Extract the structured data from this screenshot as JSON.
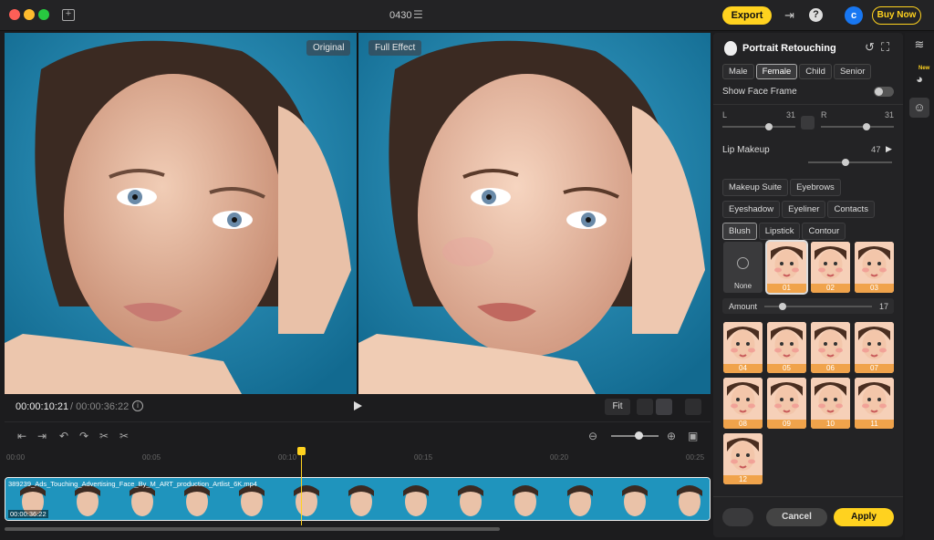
{
  "window": {
    "project_name": "0430"
  },
  "toolbar": {
    "export_label": "Export",
    "avatar_letter": "c",
    "buy_now_label": "Buy Now"
  },
  "viewer": {
    "left_label": "Original",
    "right_label": "Full Effect"
  },
  "playback": {
    "current_time": "00:00:10:21",
    "total_time": "/ 00:00:36:22",
    "fit_label": "Fit"
  },
  "timeline": {
    "ruler": [
      "00:00",
      "00:05",
      "00:10",
      "00:15",
      "00:20",
      "00:25"
    ],
    "clip_name": "389239_Ads_Touching_Advertising_Face_By_M_ART_production_Artlist_6K.mp4",
    "clip_duration": "00:00:36:22"
  },
  "panel": {
    "title": "Portrait Retouching",
    "genders": [
      "Male",
      "Female",
      "Child",
      "Senior"
    ],
    "selected_gender": "Female",
    "show_face_frame_label": "Show Face Frame",
    "show_face_frame": false,
    "left_label": "L",
    "left_value": "31",
    "right_label": "R",
    "right_value": "31",
    "lip_label": "Lip Makeup",
    "lip_value": "47",
    "categories": [
      "Makeup Suite",
      "Eyebrows",
      "Eyeshadow",
      "Eyeliner",
      "Contacts",
      "Blush",
      "Lipstick",
      "Contour"
    ],
    "selected_category": "Blush",
    "none_label": "None",
    "presets": [
      "01",
      "02",
      "03",
      "04",
      "05",
      "06",
      "07",
      "08",
      "09",
      "10",
      "11",
      "12"
    ],
    "selected_preset": "01",
    "amount_label": "Amount",
    "amount_value": "17",
    "cancel_label": "Cancel",
    "apply_label": "Apply"
  },
  "rail": {
    "new_badge": "New"
  },
  "colors": {
    "accent": "#ffd21f",
    "preset_label": "#f0a34b",
    "avatar": "#1877f2"
  }
}
